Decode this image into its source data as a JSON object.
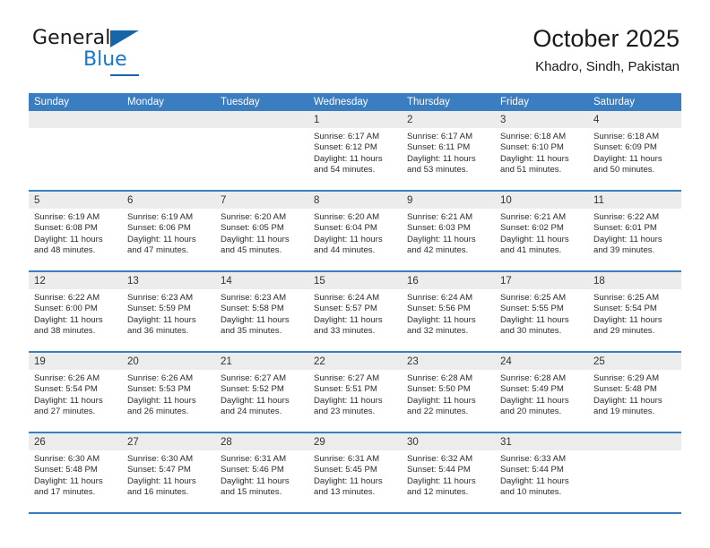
{
  "brand": {
    "word_one": "General",
    "word_two": "Blue",
    "triangle_color": "#1565a8",
    "blue_text_color": "#1578c8"
  },
  "header": {
    "title": "October 2025",
    "subtitle": "Khadro, Sindh, Pakistan"
  },
  "theme": {
    "header_blue": "#3a7dc0",
    "number_band_gray": "#ececec",
    "text_color": "#2b2b2b"
  },
  "weekdays": [
    "Sunday",
    "Monday",
    "Tuesday",
    "Wednesday",
    "Thursday",
    "Friday",
    "Saturday"
  ],
  "weeks": [
    [
      {
        "day": "",
        "sunrise": "",
        "sunset": "",
        "daylight1": "",
        "daylight2": ""
      },
      {
        "day": "",
        "sunrise": "",
        "sunset": "",
        "daylight1": "",
        "daylight2": ""
      },
      {
        "day": "",
        "sunrise": "",
        "sunset": "",
        "daylight1": "",
        "daylight2": ""
      },
      {
        "day": "1",
        "sunrise": "Sunrise: 6:17 AM",
        "sunset": "Sunset: 6:12 PM",
        "daylight1": "Daylight: 11 hours",
        "daylight2": "and 54 minutes."
      },
      {
        "day": "2",
        "sunrise": "Sunrise: 6:17 AM",
        "sunset": "Sunset: 6:11 PM",
        "daylight1": "Daylight: 11 hours",
        "daylight2": "and 53 minutes."
      },
      {
        "day": "3",
        "sunrise": "Sunrise: 6:18 AM",
        "sunset": "Sunset: 6:10 PM",
        "daylight1": "Daylight: 11 hours",
        "daylight2": "and 51 minutes."
      },
      {
        "day": "4",
        "sunrise": "Sunrise: 6:18 AM",
        "sunset": "Sunset: 6:09 PM",
        "daylight1": "Daylight: 11 hours",
        "daylight2": "and 50 minutes."
      }
    ],
    [
      {
        "day": "5",
        "sunrise": "Sunrise: 6:19 AM",
        "sunset": "Sunset: 6:08 PM",
        "daylight1": "Daylight: 11 hours",
        "daylight2": "and 48 minutes."
      },
      {
        "day": "6",
        "sunrise": "Sunrise: 6:19 AM",
        "sunset": "Sunset: 6:06 PM",
        "daylight1": "Daylight: 11 hours",
        "daylight2": "and 47 minutes."
      },
      {
        "day": "7",
        "sunrise": "Sunrise: 6:20 AM",
        "sunset": "Sunset: 6:05 PM",
        "daylight1": "Daylight: 11 hours",
        "daylight2": "and 45 minutes."
      },
      {
        "day": "8",
        "sunrise": "Sunrise: 6:20 AM",
        "sunset": "Sunset: 6:04 PM",
        "daylight1": "Daylight: 11 hours",
        "daylight2": "and 44 minutes."
      },
      {
        "day": "9",
        "sunrise": "Sunrise: 6:21 AM",
        "sunset": "Sunset: 6:03 PM",
        "daylight1": "Daylight: 11 hours",
        "daylight2": "and 42 minutes."
      },
      {
        "day": "10",
        "sunrise": "Sunrise: 6:21 AM",
        "sunset": "Sunset: 6:02 PM",
        "daylight1": "Daylight: 11 hours",
        "daylight2": "and 41 minutes."
      },
      {
        "day": "11",
        "sunrise": "Sunrise: 6:22 AM",
        "sunset": "Sunset: 6:01 PM",
        "daylight1": "Daylight: 11 hours",
        "daylight2": "and 39 minutes."
      }
    ],
    [
      {
        "day": "12",
        "sunrise": "Sunrise: 6:22 AM",
        "sunset": "Sunset: 6:00 PM",
        "daylight1": "Daylight: 11 hours",
        "daylight2": "and 38 minutes."
      },
      {
        "day": "13",
        "sunrise": "Sunrise: 6:23 AM",
        "sunset": "Sunset: 5:59 PM",
        "daylight1": "Daylight: 11 hours",
        "daylight2": "and 36 minutes."
      },
      {
        "day": "14",
        "sunrise": "Sunrise: 6:23 AM",
        "sunset": "Sunset: 5:58 PM",
        "daylight1": "Daylight: 11 hours",
        "daylight2": "and 35 minutes."
      },
      {
        "day": "15",
        "sunrise": "Sunrise: 6:24 AM",
        "sunset": "Sunset: 5:57 PM",
        "daylight1": "Daylight: 11 hours",
        "daylight2": "and 33 minutes."
      },
      {
        "day": "16",
        "sunrise": "Sunrise: 6:24 AM",
        "sunset": "Sunset: 5:56 PM",
        "daylight1": "Daylight: 11 hours",
        "daylight2": "and 32 minutes."
      },
      {
        "day": "17",
        "sunrise": "Sunrise: 6:25 AM",
        "sunset": "Sunset: 5:55 PM",
        "daylight1": "Daylight: 11 hours",
        "daylight2": "and 30 minutes."
      },
      {
        "day": "18",
        "sunrise": "Sunrise: 6:25 AM",
        "sunset": "Sunset: 5:54 PM",
        "daylight1": "Daylight: 11 hours",
        "daylight2": "and 29 minutes."
      }
    ],
    [
      {
        "day": "19",
        "sunrise": "Sunrise: 6:26 AM",
        "sunset": "Sunset: 5:54 PM",
        "daylight1": "Daylight: 11 hours",
        "daylight2": "and 27 minutes."
      },
      {
        "day": "20",
        "sunrise": "Sunrise: 6:26 AM",
        "sunset": "Sunset: 5:53 PM",
        "daylight1": "Daylight: 11 hours",
        "daylight2": "and 26 minutes."
      },
      {
        "day": "21",
        "sunrise": "Sunrise: 6:27 AM",
        "sunset": "Sunset: 5:52 PM",
        "daylight1": "Daylight: 11 hours",
        "daylight2": "and 24 minutes."
      },
      {
        "day": "22",
        "sunrise": "Sunrise: 6:27 AM",
        "sunset": "Sunset: 5:51 PM",
        "daylight1": "Daylight: 11 hours",
        "daylight2": "and 23 minutes."
      },
      {
        "day": "23",
        "sunrise": "Sunrise: 6:28 AM",
        "sunset": "Sunset: 5:50 PM",
        "daylight1": "Daylight: 11 hours",
        "daylight2": "and 22 minutes."
      },
      {
        "day": "24",
        "sunrise": "Sunrise: 6:28 AM",
        "sunset": "Sunset: 5:49 PM",
        "daylight1": "Daylight: 11 hours",
        "daylight2": "and 20 minutes."
      },
      {
        "day": "25",
        "sunrise": "Sunrise: 6:29 AM",
        "sunset": "Sunset: 5:48 PM",
        "daylight1": "Daylight: 11 hours",
        "daylight2": "and 19 minutes."
      }
    ],
    [
      {
        "day": "26",
        "sunrise": "Sunrise: 6:30 AM",
        "sunset": "Sunset: 5:48 PM",
        "daylight1": "Daylight: 11 hours",
        "daylight2": "and 17 minutes."
      },
      {
        "day": "27",
        "sunrise": "Sunrise: 6:30 AM",
        "sunset": "Sunset: 5:47 PM",
        "daylight1": "Daylight: 11 hours",
        "daylight2": "and 16 minutes."
      },
      {
        "day": "28",
        "sunrise": "Sunrise: 6:31 AM",
        "sunset": "Sunset: 5:46 PM",
        "daylight1": "Daylight: 11 hours",
        "daylight2": "and 15 minutes."
      },
      {
        "day": "29",
        "sunrise": "Sunrise: 6:31 AM",
        "sunset": "Sunset: 5:45 PM",
        "daylight1": "Daylight: 11 hours",
        "daylight2": "and 13 minutes."
      },
      {
        "day": "30",
        "sunrise": "Sunrise: 6:32 AM",
        "sunset": "Sunset: 5:44 PM",
        "daylight1": "Daylight: 11 hours",
        "daylight2": "and 12 minutes."
      },
      {
        "day": "31",
        "sunrise": "Sunrise: 6:33 AM",
        "sunset": "Sunset: 5:44 PM",
        "daylight1": "Daylight: 11 hours",
        "daylight2": "and 10 minutes."
      },
      {
        "day": "",
        "sunrise": "",
        "sunset": "",
        "daylight1": "",
        "daylight2": ""
      }
    ]
  ]
}
